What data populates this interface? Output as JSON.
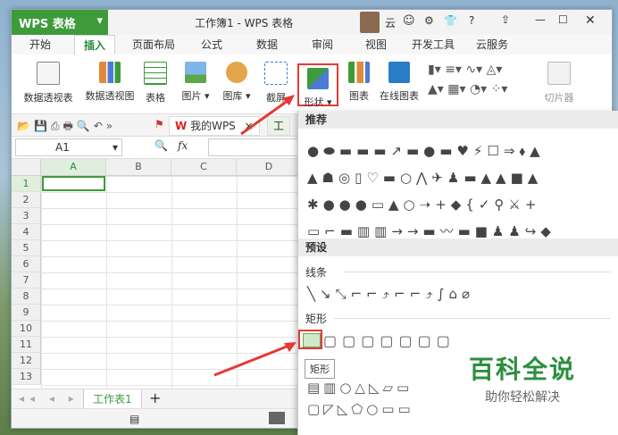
{
  "app": {
    "name": "WPS 表格",
    "window_title": "工作簿1 - WPS 表格",
    "user": "云",
    "help": "?"
  },
  "tabs": [
    "开始",
    "插入",
    "页面布局",
    "公式",
    "数据",
    "审阅",
    "视图",
    "开发工具",
    "云服务"
  ],
  "ribbon": {
    "buttons": [
      "数据透视表",
      "数据透视图",
      "表格",
      "图片",
      "图库",
      "截屏",
      "形状",
      "图表",
      "在线图表",
      "切片器"
    ]
  },
  "toolbar2": {
    "doc_tab_1": "我的WPS",
    "doc_tab_2": "工"
  },
  "formula": {
    "cell_ref": "A1",
    "fx": "fx"
  },
  "grid": {
    "columns": [
      "A",
      "B",
      "C",
      "D"
    ],
    "rows": [
      "1",
      "2",
      "3",
      "4",
      "5",
      "6",
      "7",
      "8",
      "9",
      "10",
      "11",
      "12",
      "13"
    ]
  },
  "sheets": {
    "active": "工作表1",
    "add": "+"
  },
  "panel": {
    "recommended": "推荐",
    "preset": "预设",
    "lines": "线条",
    "rectangles": "矩形",
    "tooltip": "矩形"
  },
  "watermark": {
    "title": "百科全说",
    "subtitle": "助你轻松解决"
  },
  "colors": {
    "brand": "#3d9b3a",
    "highlight": "#e53935",
    "accent_green": "#2b8a3e"
  }
}
